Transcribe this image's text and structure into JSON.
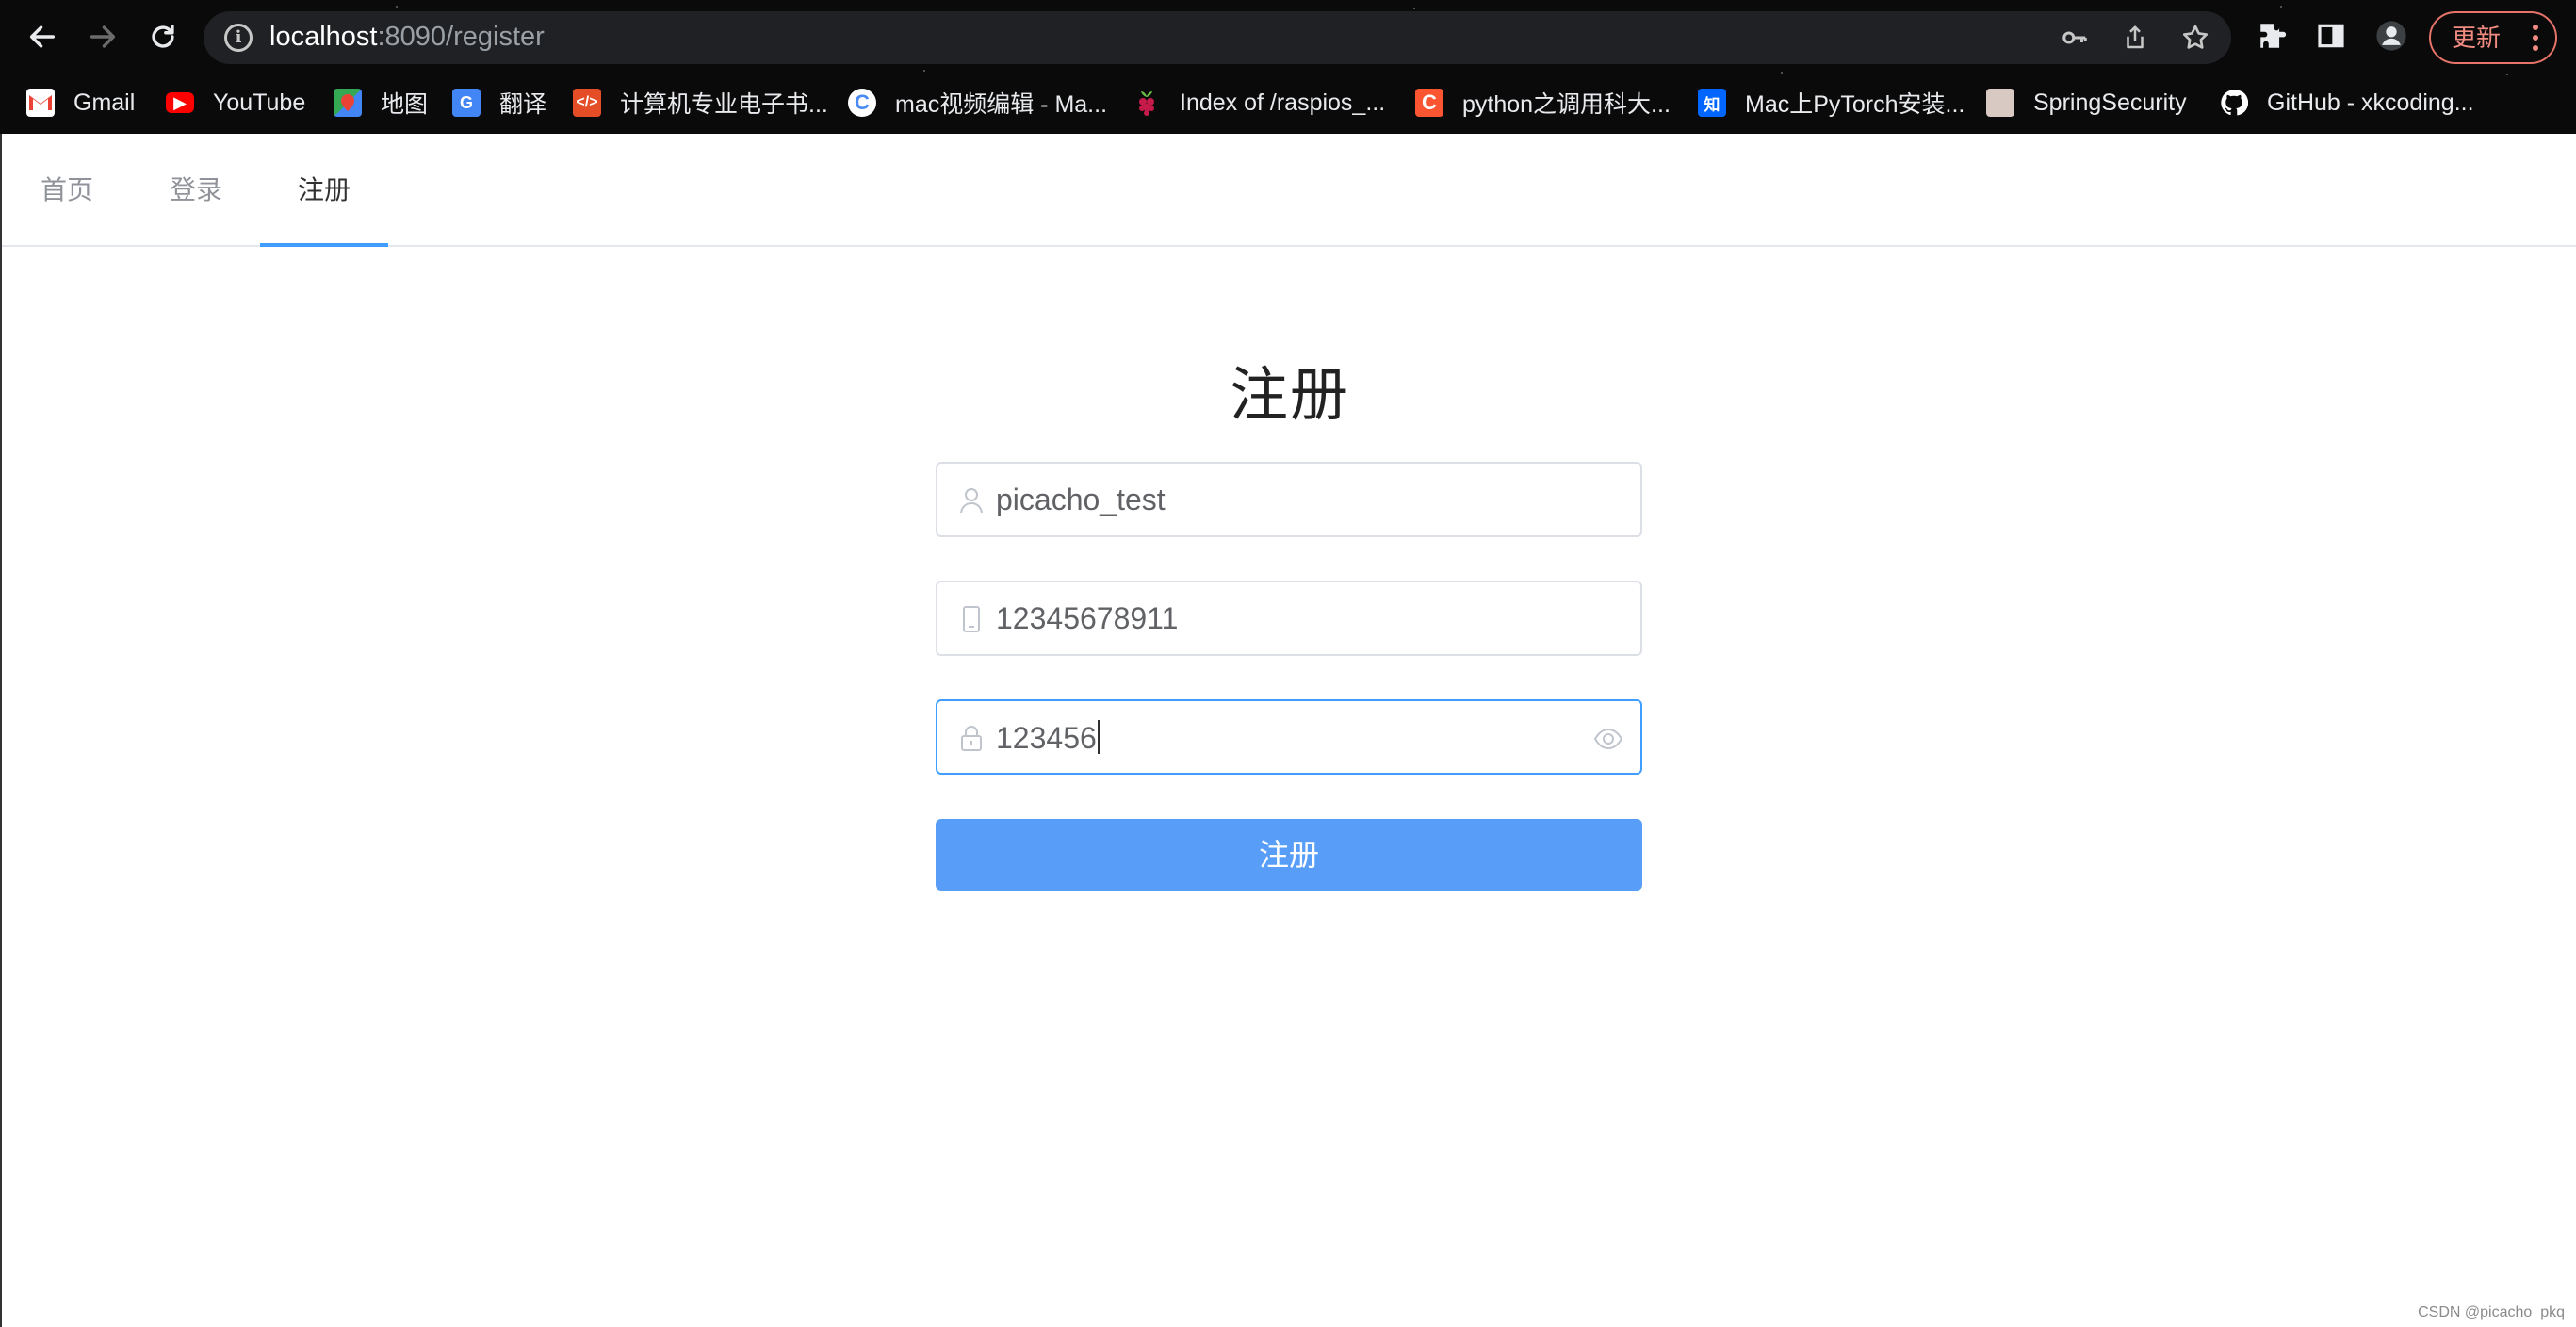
{
  "browser": {
    "url_host": "localhost",
    "url_rest": ":8090/register",
    "update_label": "更新",
    "bookmarks": [
      {
        "label": "Gmail",
        "icon": "gmail-icon",
        "color": "#ea4335"
      },
      {
        "label": "YouTube",
        "icon": "youtube-icon",
        "color": "#ff0000"
      },
      {
        "label": "地图",
        "icon": "maps-icon",
        "color": "#34a853"
      },
      {
        "label": "翻译",
        "icon": "translate-icon",
        "color": "#4285f4"
      },
      {
        "label": "计算机专业电子书...",
        "icon": "code-icon",
        "color": "#e44d26"
      },
      {
        "label": "mac视频编辑 - Ma...",
        "icon": "c-icon",
        "color": "#4a8af4"
      },
      {
        "label": "Index of /raspios_...",
        "icon": "raspberry-icon",
        "color": "#c51a4a"
      },
      {
        "label": "python之调用科大...",
        "icon": "csdn-icon",
        "color": "#fc5531"
      },
      {
        "label": "Mac上PyTorch安装...",
        "icon": "zhihu-icon",
        "color": "#0066ff"
      },
      {
        "label": "SpringSecurity",
        "icon": "avatar-icon",
        "color": "#d8c9c3"
      },
      {
        "label": "GitHub - xkcoding...",
        "icon": "github-icon",
        "color": "#ffffff"
      }
    ]
  },
  "nav": {
    "tabs": [
      {
        "label": "首页"
      },
      {
        "label": "登录"
      },
      {
        "label": "注册"
      }
    ],
    "active_tab": "注册"
  },
  "form": {
    "title": "注册",
    "username": "picacho_test",
    "phone": "12345678911",
    "password": "123456",
    "submit_label": "注册"
  },
  "colors": {
    "accent": "#409eff",
    "button": "#589ef8"
  },
  "watermark": "CSDN @picacho_pkq"
}
